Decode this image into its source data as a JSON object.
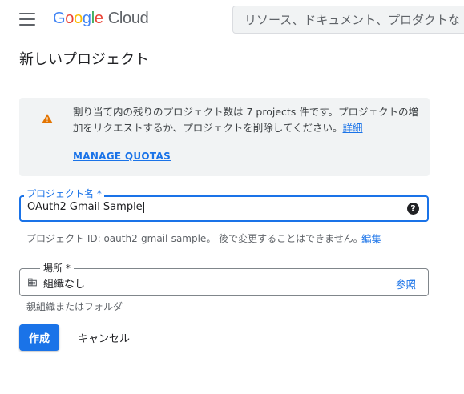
{
  "header": {
    "logo_google": [
      "G",
      "o",
      "o",
      "g",
      "l",
      "e"
    ],
    "logo_cloud": "Cloud",
    "search_placeholder": "リソース、ドキュメント、プロダクトな"
  },
  "page": {
    "title": "新しいプロジェクト"
  },
  "notice": {
    "text": "割り当て内の残りのプロジェクト数は 7 projects 件です。プロジェクトの増加をリクエストするか、プロジェクトを削除してください。",
    "link": "詳細",
    "manage_quotas": "MANAGE QUOTAS"
  },
  "form": {
    "project_name_label": "プロジェクト名 *",
    "project_name_value": "OAuth2 Gmail Sample",
    "project_id_hint": "プロジェクト ID: oauth2-gmail-sample。 後で変更することはできません。",
    "edit_label": "編集",
    "location_label": "場所 *",
    "location_value": "組織なし",
    "browse_label": "参照",
    "location_hint": "親組織またはフォルダ"
  },
  "actions": {
    "create": "作成",
    "cancel": "キャンセル"
  },
  "colors": {
    "accent": "#1a73e8",
    "warning": "#e37400",
    "notice_bg": "#f1f3f4"
  }
}
